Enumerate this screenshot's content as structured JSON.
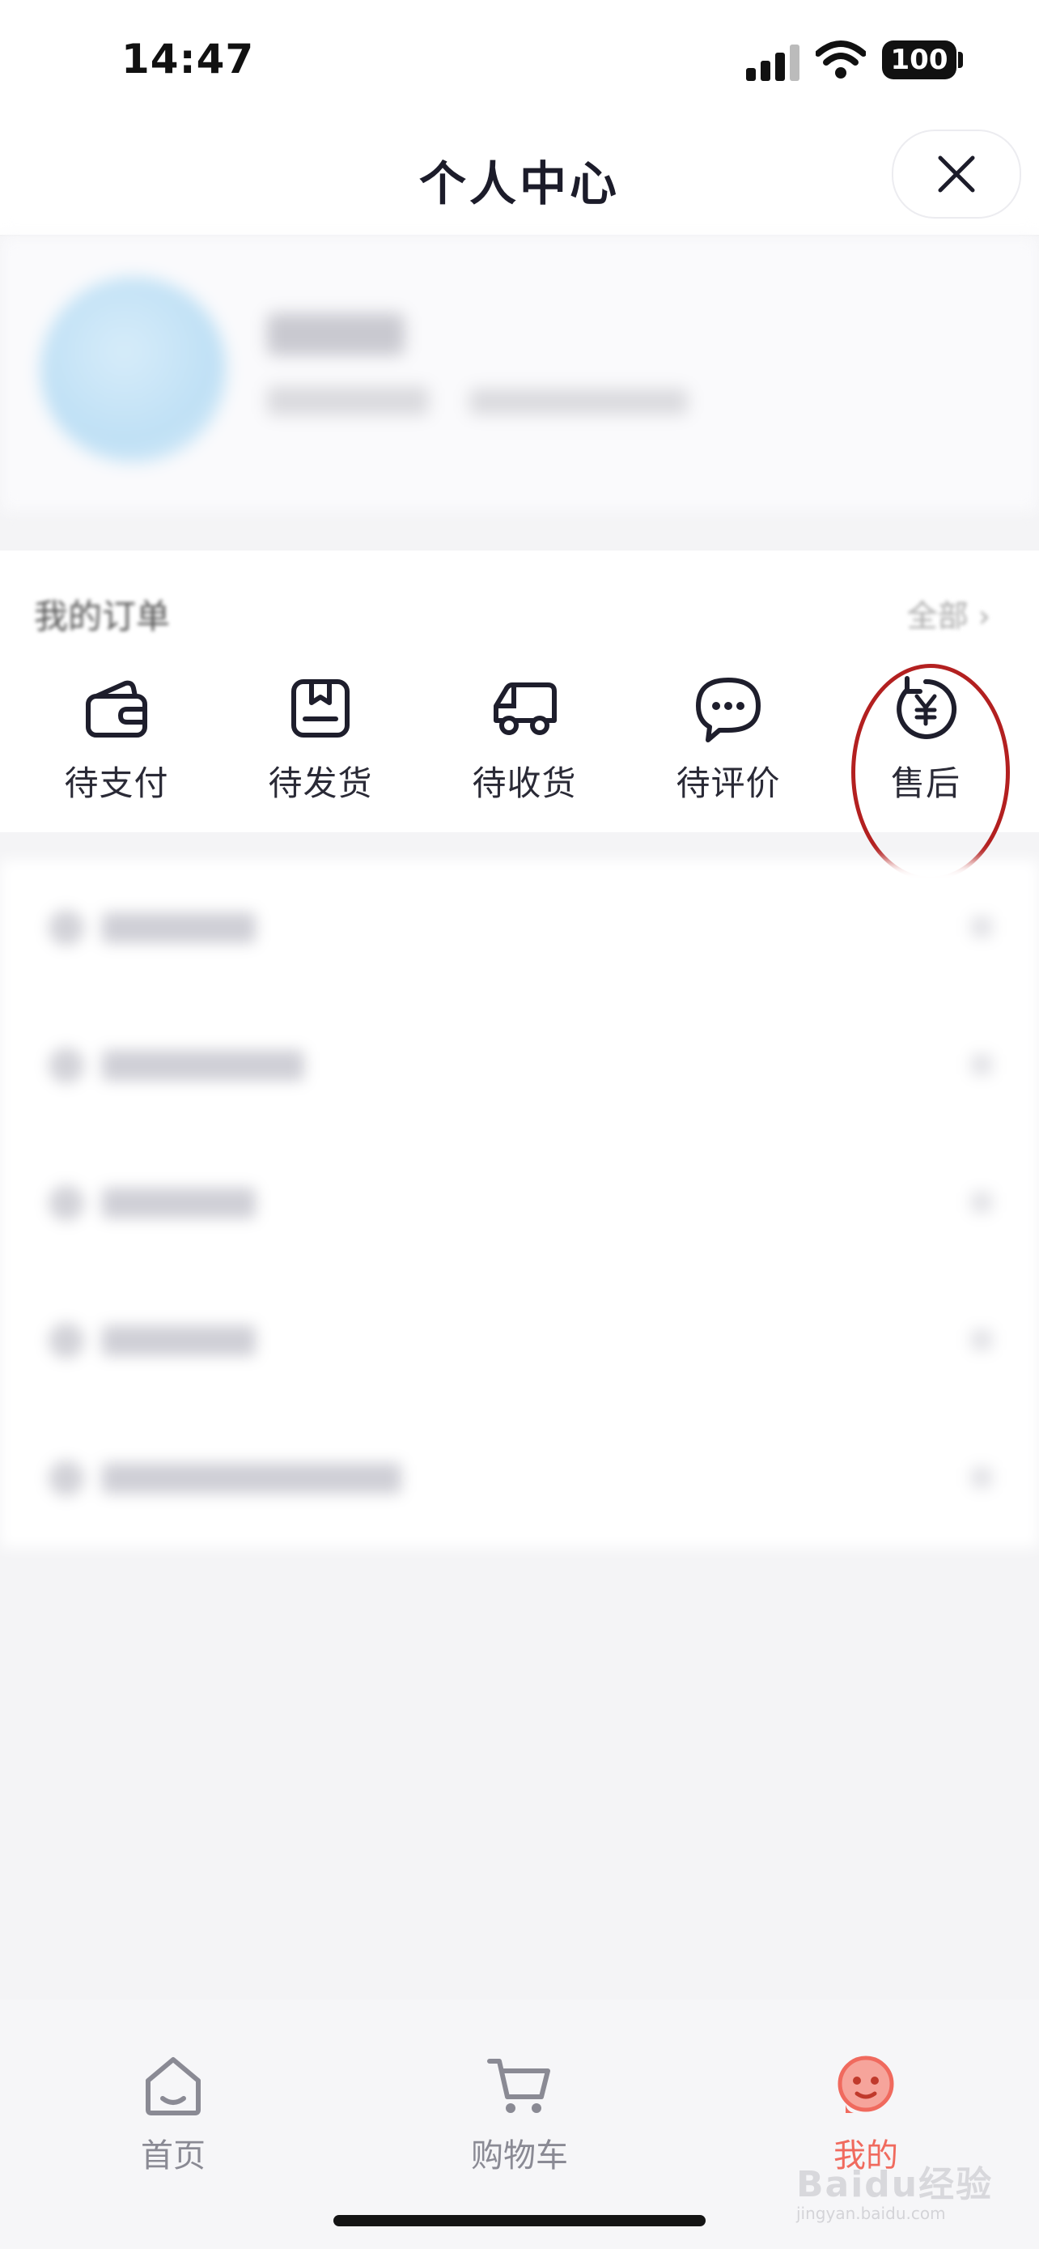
{
  "status_bar": {
    "time": "14:47",
    "battery": "100"
  },
  "header": {
    "title": "个人中心"
  },
  "orders": {
    "title": "我的订单",
    "all_label": "全部",
    "items": [
      {
        "label": "待支付",
        "icon": "wallet-icon"
      },
      {
        "label": "待发货",
        "icon": "box-icon"
      },
      {
        "label": "待收货",
        "icon": "truck-icon"
      },
      {
        "label": "待评价",
        "icon": "chat-bubble-icon"
      },
      {
        "label": "售后",
        "icon": "refund-yen-icon"
      }
    ]
  },
  "tabbar": {
    "items": [
      {
        "label": "首页",
        "icon": "home-icon"
      },
      {
        "label": "购物车",
        "icon": "cart-icon"
      },
      {
        "label": "我的",
        "icon": "profile-face-icon"
      }
    ],
    "active_color": "#f06a5e",
    "inactive_color": "#8a8a94"
  },
  "watermark": {
    "text": "Baidu经验",
    "url": "jingyan.baidu.com"
  },
  "annotation_color": "#b32020"
}
